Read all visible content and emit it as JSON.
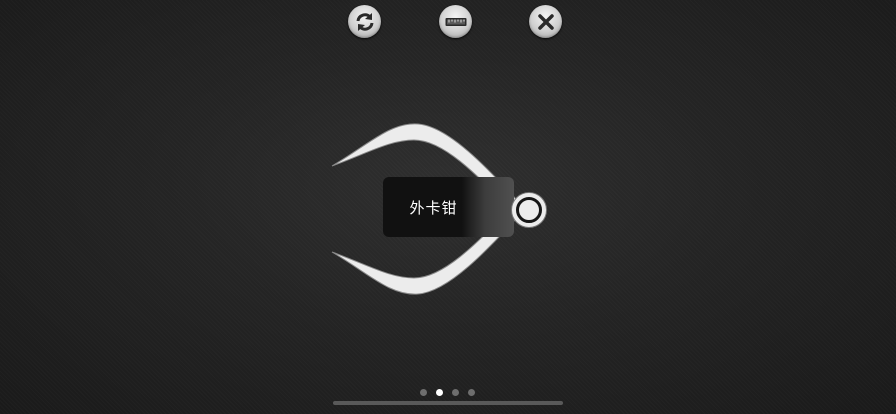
{
  "toolbar": {
    "buttons": [
      {
        "id": "refresh",
        "icon": "refresh-arrows-icon"
      },
      {
        "id": "ruler",
        "icon": "ruler-icon"
      },
      {
        "id": "close",
        "icon": "close-icon"
      }
    ]
  },
  "tool": {
    "name": "外卡钳",
    "icon": "outside-caliper-icon"
  },
  "pager": {
    "page_count": 4,
    "current_page": 2
  },
  "colors": {
    "background": "#242424",
    "caliper": "#ececec",
    "label_box": "#111111",
    "dot_active": "#ffffff",
    "dot_inactive": "#6e6e6e"
  }
}
